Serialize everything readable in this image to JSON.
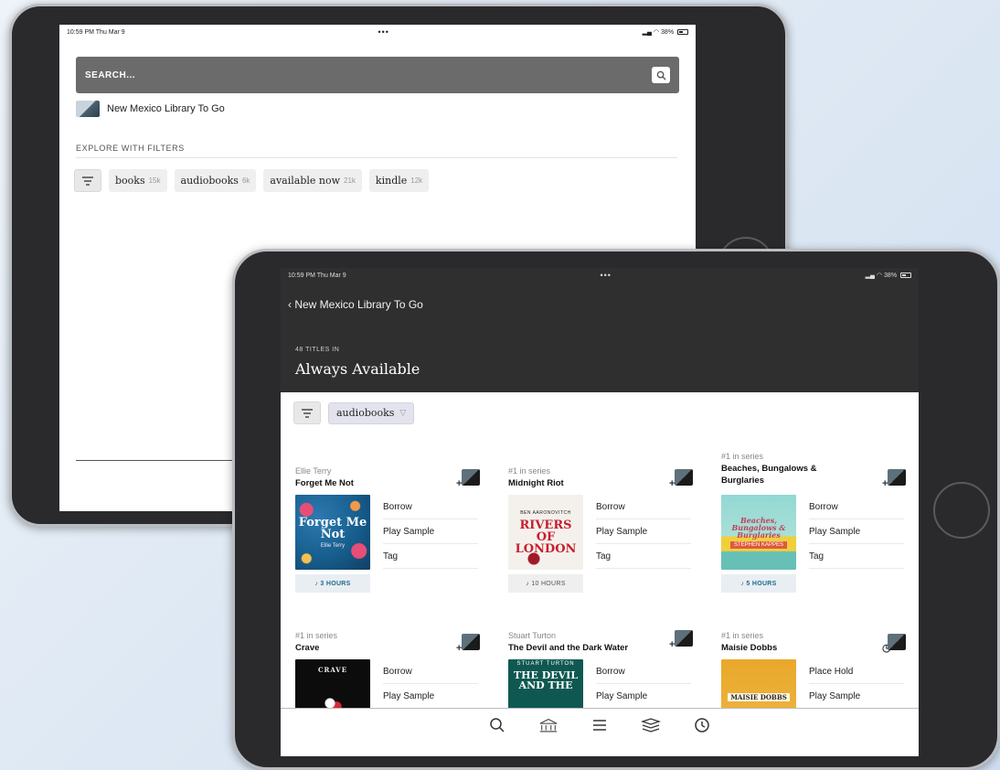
{
  "back_tablet": {
    "status": {
      "time": "10:59 PM  Thu Mar 9",
      "dots": "•••",
      "battery": "38%"
    },
    "search": {
      "placeholder": "SEARCH..."
    },
    "library": {
      "name": "New Mexico Library To Go"
    },
    "explore_label": "EXPLORE WITH FILTERS",
    "filters": [
      {
        "label": "books",
        "count": "15k"
      },
      {
        "label": "audiobooks",
        "count": "6k"
      },
      {
        "label": "available now",
        "count": "21k"
      },
      {
        "label": "kindle",
        "count": "12k"
      }
    ]
  },
  "front_tablet": {
    "status": {
      "time": "10:59 PM  Thu Mar 9",
      "dots": "•••",
      "battery": "38%"
    },
    "back_link": "New Mexico Library To Go",
    "titles_count": "48 TITLES IN",
    "collection_title": "Always Available",
    "active_filter": "audiobooks",
    "books": [
      {
        "top": "Ellie Terry",
        "title": "Forget Me Not",
        "cover_text": "Forget Me Not",
        "cover_sub": "Ellie Terry",
        "actions": [
          "Borrow",
          "Play Sample",
          "Tag"
        ],
        "hours": "3 HOURS"
      },
      {
        "top": "#1 in series",
        "title": "Midnight Riot",
        "cover_author": "BEN AARONOVITCH",
        "cover_text": "RIVERS OF LONDON",
        "actions": [
          "Borrow",
          "Play Sample",
          "Tag"
        ],
        "hours": "10 HOURS"
      },
      {
        "top": "#1 in series",
        "title": "Beaches, Bungalows & Burglaries",
        "cover_text": "Beaches, Bungalows & Burglaries",
        "cover_sub": "STEPHEN KAPPES",
        "actions": [
          "Borrow",
          "Play Sample",
          "Tag"
        ],
        "hours": "5 HOURS"
      },
      {
        "top": "#1 in series",
        "title": "Crave",
        "cover_text": "CRAVE",
        "actions": [
          "Borrow",
          "Play Sample"
        ]
      },
      {
        "top": "Stuart Turton",
        "title": "The Devil and the Dark Water",
        "cover_author": "STUART TURTON",
        "cover_text": "THE DEVIL AND THE",
        "actions": [
          "Borrow",
          "Play Sample"
        ]
      },
      {
        "top": "#1 in series",
        "title": "Maisie Dobbs",
        "cover_text": "MAISIE DOBBS",
        "actions": [
          "Place Hold",
          "Play Sample"
        ]
      }
    ],
    "tabs": [
      "search-icon",
      "library-icon",
      "menu-icon",
      "shelf-icon",
      "history-icon"
    ]
  },
  "colors": {
    "header_bg": "#2f2f30",
    "accent": "#1d6b8a",
    "chip_bg": "#efefef"
  }
}
